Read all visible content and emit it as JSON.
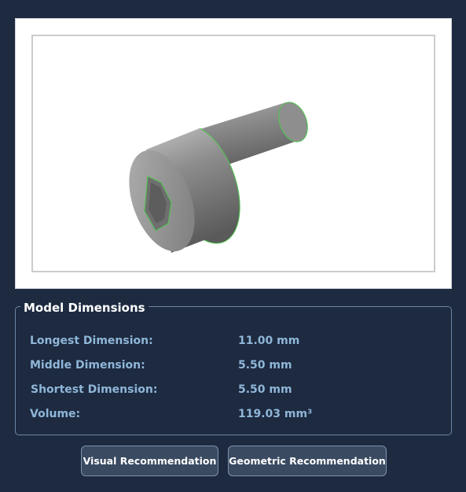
{
  "viewer": {
    "model_description": "3D model of a socket head cap screw",
    "edge_highlight_color": "#4cc94c"
  },
  "dimensions_panel": {
    "title": "Model Dimensions",
    "rows": [
      {
        "label": "Longest Dimension:",
        "value": "11.00 mm"
      },
      {
        "label": "Middle Dimension:",
        "value": "5.50 mm"
      },
      {
        "label": "Shortest Dimension:",
        "value": "5.50 mm"
      },
      {
        "label": "Volume:",
        "value": "119.03 mm³"
      }
    ]
  },
  "buttons": {
    "visual_label": "Visual Recommendation",
    "geometric_label": "Geometric Recommendation"
  },
  "colors": {
    "background": "#1d2a40",
    "label_text": "#8fb6d8",
    "button_fill": "#3a4a61",
    "panel_border": "#6e86a6"
  }
}
